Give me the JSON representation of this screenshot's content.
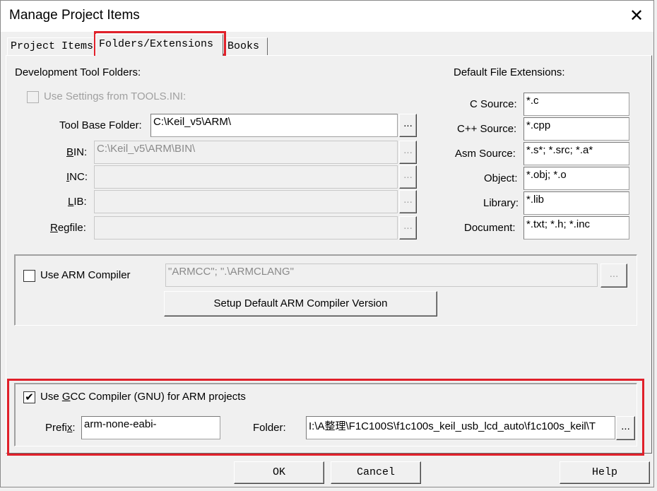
{
  "window": {
    "title": "Manage Project Items",
    "close_glyph": "✕"
  },
  "tabs": [
    {
      "label": "Project Items",
      "active": false
    },
    {
      "label": "Folders/Extensions",
      "active": true
    },
    {
      "label": "Books",
      "active": false
    }
  ],
  "dev_folders": {
    "heading": "Development Tool Folders:",
    "use_settings_label": "Use Settings from TOOLS.INI:",
    "use_settings_checked": false,
    "tool_base_label": "Tool Base Folder:",
    "tool_base_value": "C:\\Keil_v5\\ARM\\",
    "bin_label_u": "B",
    "bin_label_rest": "IN:",
    "bin_value": "C:\\Keil_v5\\ARM\\BIN\\",
    "inc_label_u": "I",
    "inc_label_rest": "NC:",
    "inc_value": "",
    "lib_label_u": "L",
    "lib_label_rest": "IB:",
    "lib_value": "",
    "regfile_label_u": "R",
    "regfile_label_rest": "egfile:",
    "regfile_value": "",
    "browse_label": "..."
  },
  "extensions": {
    "heading": "Default File Extensions:",
    "items": [
      {
        "label": "C Source:",
        "value": "*.c"
      },
      {
        "label": "C++ Source:",
        "value": "*.cpp"
      },
      {
        "label": "Asm Source:",
        "value": "*.s*; *.src; *.a*"
      },
      {
        "label": "Object:",
        "value": "*.obj; *.o"
      },
      {
        "label": "Library:",
        "value": "*.lib"
      },
      {
        "label": "Document:",
        "value": "*.txt; *.h; *.inc"
      }
    ]
  },
  "arm_compiler": {
    "checkbox_label": "Use ARM Compiler",
    "checked": false,
    "value": "\"ARMCC\"; \".\\ARMCLANG\"",
    "browse_label": "...",
    "setup_button": "Setup Default ARM Compiler Version"
  },
  "gcc": {
    "checkbox_label_pre": "Use ",
    "checkbox_label_u": "G",
    "checkbox_label_post": "CC Compiler (GNU) for ARM projects",
    "checked": true,
    "check_glyph": "✔",
    "prefix_label_pre": "Prefi",
    "prefix_label_u": "x",
    "prefix_label_post": ":",
    "prefix_value": "arm-none-eabi-",
    "folder_label": "Folder:",
    "folder_value": "I:\\A整理\\F1C100S\\f1c100s_keil_usb_lcd_auto\\f1c100s_keil\\T",
    "browse_label": "..."
  },
  "buttons": {
    "ok": "OK",
    "cancel": "Cancel",
    "help": "Help"
  },
  "highlight_color": "#e0202a"
}
